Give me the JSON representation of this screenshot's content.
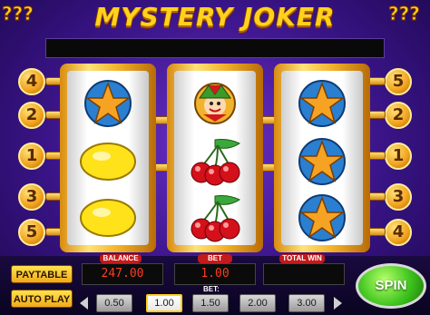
{
  "title": "MYSTERY JOKER",
  "line_numbers_left": [
    "4",
    "2",
    "1",
    "3",
    "5"
  ],
  "line_numbers_right": [
    "5",
    "2",
    "1",
    "3",
    "4"
  ],
  "reels": [
    [
      "star",
      "lemon",
      "lemon"
    ],
    [
      "joker",
      "cherries",
      "cherries"
    ],
    [
      "star",
      "star",
      "star"
    ]
  ],
  "buttons": {
    "paytable": "PAYTABLE",
    "autoplay": "AUTO PLAY",
    "spin": "SPIN"
  },
  "displays": {
    "balance_label": "BALANCE",
    "balance_value": "247.00",
    "bet_label": "BET",
    "bet_value": "1.00",
    "totalwin_label": "TOTAL WIN",
    "totalwin_value": ""
  },
  "bet_selector": {
    "label": "BET:",
    "options": [
      "0.50",
      "1.00",
      "1.50",
      "2.00",
      "3.00"
    ],
    "selected": "1.00"
  },
  "colors": {
    "accent_gold": "#ffd21c",
    "display_red": "#ff3b1e",
    "spin_green": "#3fc41e"
  }
}
